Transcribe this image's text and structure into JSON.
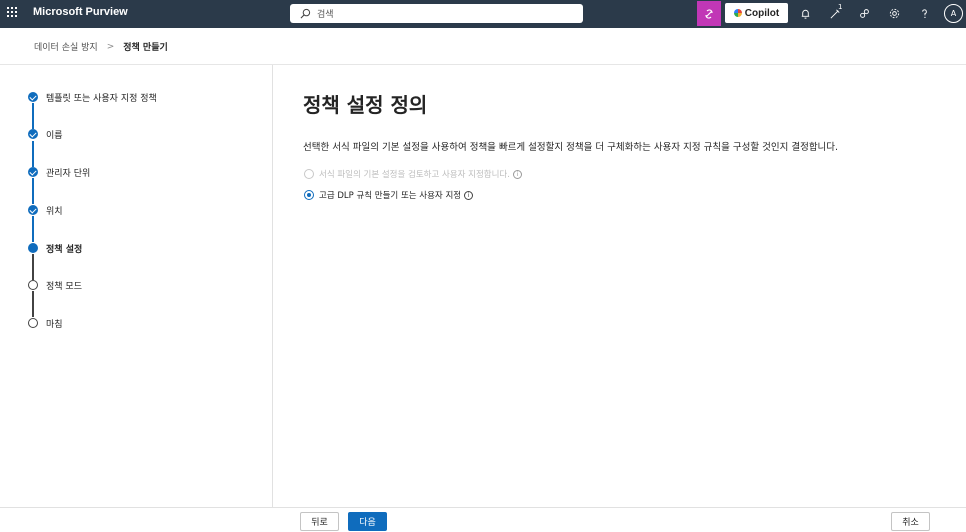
{
  "topbar": {
    "app_name": "Microsoft Purview",
    "search_placeholder": "검색",
    "copilot_label": "Copilot",
    "notification_count": "1",
    "avatar_initial": "A"
  },
  "breadcrumb": {
    "parent": "데이터 손실 방지",
    "separator": ">",
    "current": "정책 만들기"
  },
  "steps": [
    {
      "label": "템플릿 또는 사용자 지정 정책",
      "state": "done"
    },
    {
      "label": "이름",
      "state": "done"
    },
    {
      "label": "관리자 단위",
      "state": "done"
    },
    {
      "label": "위치",
      "state": "done"
    },
    {
      "label": "정책 설정",
      "state": "current"
    },
    {
      "label": "정책 모드",
      "state": "todo"
    },
    {
      "label": "마침",
      "state": "todo"
    }
  ],
  "main": {
    "heading": "정책 설정 정의",
    "description": "선택한 서식 파일의 기본 설정을 사용하여 정책을 빠르게 설정할지 정책을 더 구체화하는 사용자 지정 규칙을 구성할 것인지 결정합니다.",
    "options": [
      {
        "label": "서식 파일의 기본 설정을 검토하고 사용자 지정합니다.",
        "selected": false,
        "disabled": true
      },
      {
        "label": "고급 DLP 규칙 만들기 또는 사용자 지정",
        "selected": true,
        "disabled": false
      }
    ]
  },
  "footer": {
    "back_label": "뒤로",
    "next_label": "다음",
    "cancel_label": "취소"
  },
  "colors": {
    "topbar": "#2b3a4a",
    "accent": "#0f6cbd",
    "copilot": "#c137b6"
  }
}
